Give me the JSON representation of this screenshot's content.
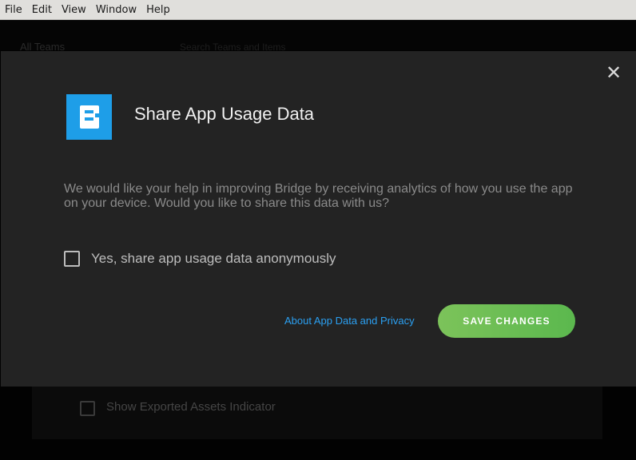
{
  "menubar": {
    "items": [
      "File",
      "Edit",
      "View",
      "Window",
      "Help"
    ]
  },
  "background": {
    "header_text": "All Teams",
    "search_placeholder": "Search Teams and Items",
    "panel_option_label": "Show Exported Assets Indicator"
  },
  "dialog": {
    "title": "Share App Usage Data",
    "body": "We would like your help in improving Bridge by receiving analytics of how you use the app on your device. Would you like to share this data with us?",
    "option_label": "Yes, share app usage data anonymously",
    "option_checked": false,
    "privacy_link": "About App Data and Privacy",
    "save_button": "SAVE CHANGES",
    "close_icon": "close-icon",
    "logo_icon": "bridge-logo-icon"
  },
  "colors": {
    "accent_blue": "#1e9ee8",
    "link_blue": "#2ba0f2",
    "save_green": "#6abf55",
    "dialog_bg": "#232323"
  }
}
